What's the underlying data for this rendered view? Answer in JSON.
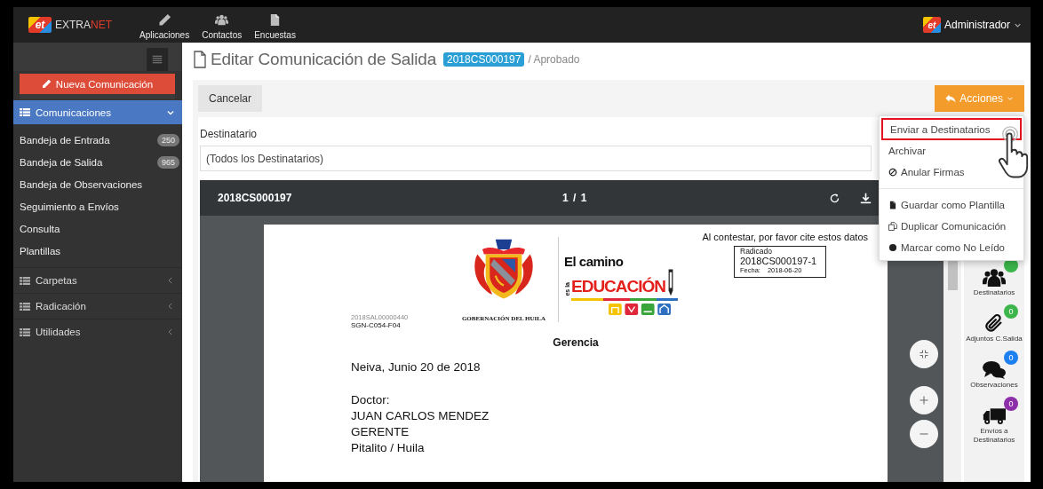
{
  "navbar": {
    "logo": {
      "badge": "et",
      "text": "EXTRA",
      "accent": "NET"
    },
    "items": [
      {
        "label": "Aplicaciones",
        "kind": "apps"
      },
      {
        "label": "Contactos",
        "kind": "contacts"
      },
      {
        "label": "Encuestas",
        "kind": "surveys"
      }
    ],
    "user": {
      "avatar": "et",
      "name": "Administrador"
    }
  },
  "sidebar": {
    "new_button": "Nueva Comunicación",
    "sections": [
      {
        "label": "Comunicaciones",
        "selected": true,
        "expanded": true,
        "children": [
          {
            "label": "Bandeja de Entrada",
            "badge": "250"
          },
          {
            "label": "Bandeja de Salida",
            "badge": "965"
          },
          {
            "label": "Bandeja de Observaciones"
          },
          {
            "label": "Seguimiento a Envíos"
          },
          {
            "label": "Consulta"
          },
          {
            "label": "Plantillas"
          }
        ]
      },
      {
        "label": "Carpetas",
        "selected": false,
        "expanded": false
      },
      {
        "label": "Radicación",
        "selected": false,
        "expanded": false
      },
      {
        "label": "Utilidades",
        "selected": false,
        "expanded": false
      }
    ]
  },
  "page": {
    "title": "Editar Comunicación de Salida",
    "badge": "2018CS000197",
    "status": "/ Aprobado"
  },
  "toolbar": {
    "cancel": "Cancelar",
    "actions": "Acciones"
  },
  "actions_menu": {
    "items": [
      {
        "label": "Enviar a Destinatarios",
        "kind": "send",
        "highlighted": true,
        "divider_before": false
      },
      {
        "label": "Archivar",
        "kind": "archive",
        "highlighted": false,
        "divider_before": false
      },
      {
        "label": "Anular Firmas",
        "kind": "void",
        "highlighted": false,
        "divider_before": false
      },
      {
        "label": "Guardar como Plantilla",
        "kind": "template",
        "highlighted": false,
        "divider_before": true
      },
      {
        "label": "Duplicar Comunicación",
        "kind": "duplicate",
        "highlighted": false,
        "divider_before": false
      },
      {
        "label": "Marcar como No Leído",
        "kind": "unread",
        "highlighted": false,
        "divider_before": false
      }
    ]
  },
  "recipient": {
    "label": "Destinatario",
    "value": "(Todos los Destinatarios)"
  },
  "viewer": {
    "title": "2018CS000197",
    "page_counter": "1 / 1",
    "document": {
      "cite_note": "Al contestar, por favor cite estos datos",
      "filing": {
        "label": "Radicado",
        "number": "2018CS000197-1",
        "date_label": "Fecha:",
        "date": "2018-06-20"
      },
      "issuer": "GOBERNACIÓN DEL HUILA",
      "slogan": {
        "line1": "El camino",
        "prefix": "es la",
        "line2": "EDUCACIÓN"
      },
      "reference": "2018SAL00000440",
      "form_code": "SGN-C054-F04",
      "department": "Gerencia",
      "place_date": "Neiva, Junio 20 de 2018",
      "salutation": "Doctor:",
      "recipient_lines": [
        "JUAN CARLOS MENDEZ",
        "GERENTE",
        "Pitalito / Huila"
      ]
    }
  },
  "side_panel": {
    "items": [
      {
        "label": "Destinatarios",
        "kind": "recipients",
        "color": "#3cb54a"
      },
      {
        "label": "Adjuntos C.Salida",
        "kind": "attachments",
        "count": "0",
        "color": "#3cb54a"
      },
      {
        "label": "Observaciones",
        "kind": "comments",
        "count": "0",
        "color": "#1e7ff0"
      },
      {
        "label": "Envíos a Destinatarios",
        "kind": "shipments",
        "count": "0",
        "color": "#8e2faa"
      }
    ]
  }
}
